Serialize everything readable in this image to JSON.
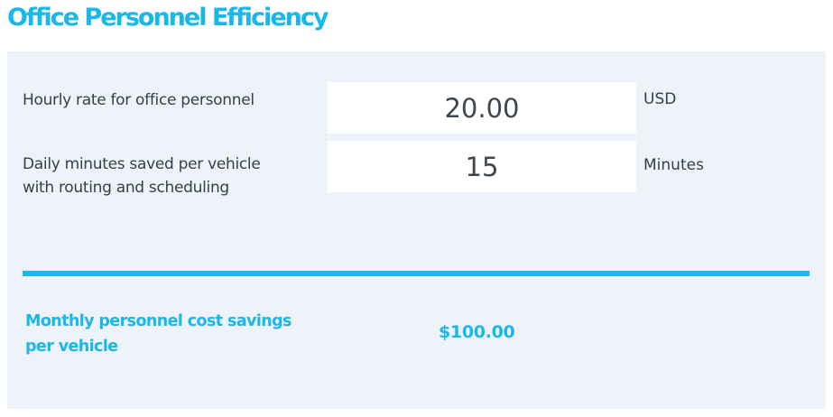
{
  "page": {
    "title": "Office Personnel Efficiency"
  },
  "inputs": [
    {
      "label": "Hourly rate for office personnel",
      "value": "20.00",
      "unit": "USD"
    },
    {
      "label_line1": "Daily minutes saved per vehicle",
      "label_line2": "with routing and scheduling",
      "value": "15",
      "unit": "Minutes"
    }
  ],
  "result": {
    "label_line1": "Monthly personnel cost savings",
    "label_line2": "per vehicle",
    "value": "$100.00"
  },
  "colors": {
    "accent": "#1ab7ea",
    "panel": "#eef2f9",
    "text": "#333f4a"
  }
}
